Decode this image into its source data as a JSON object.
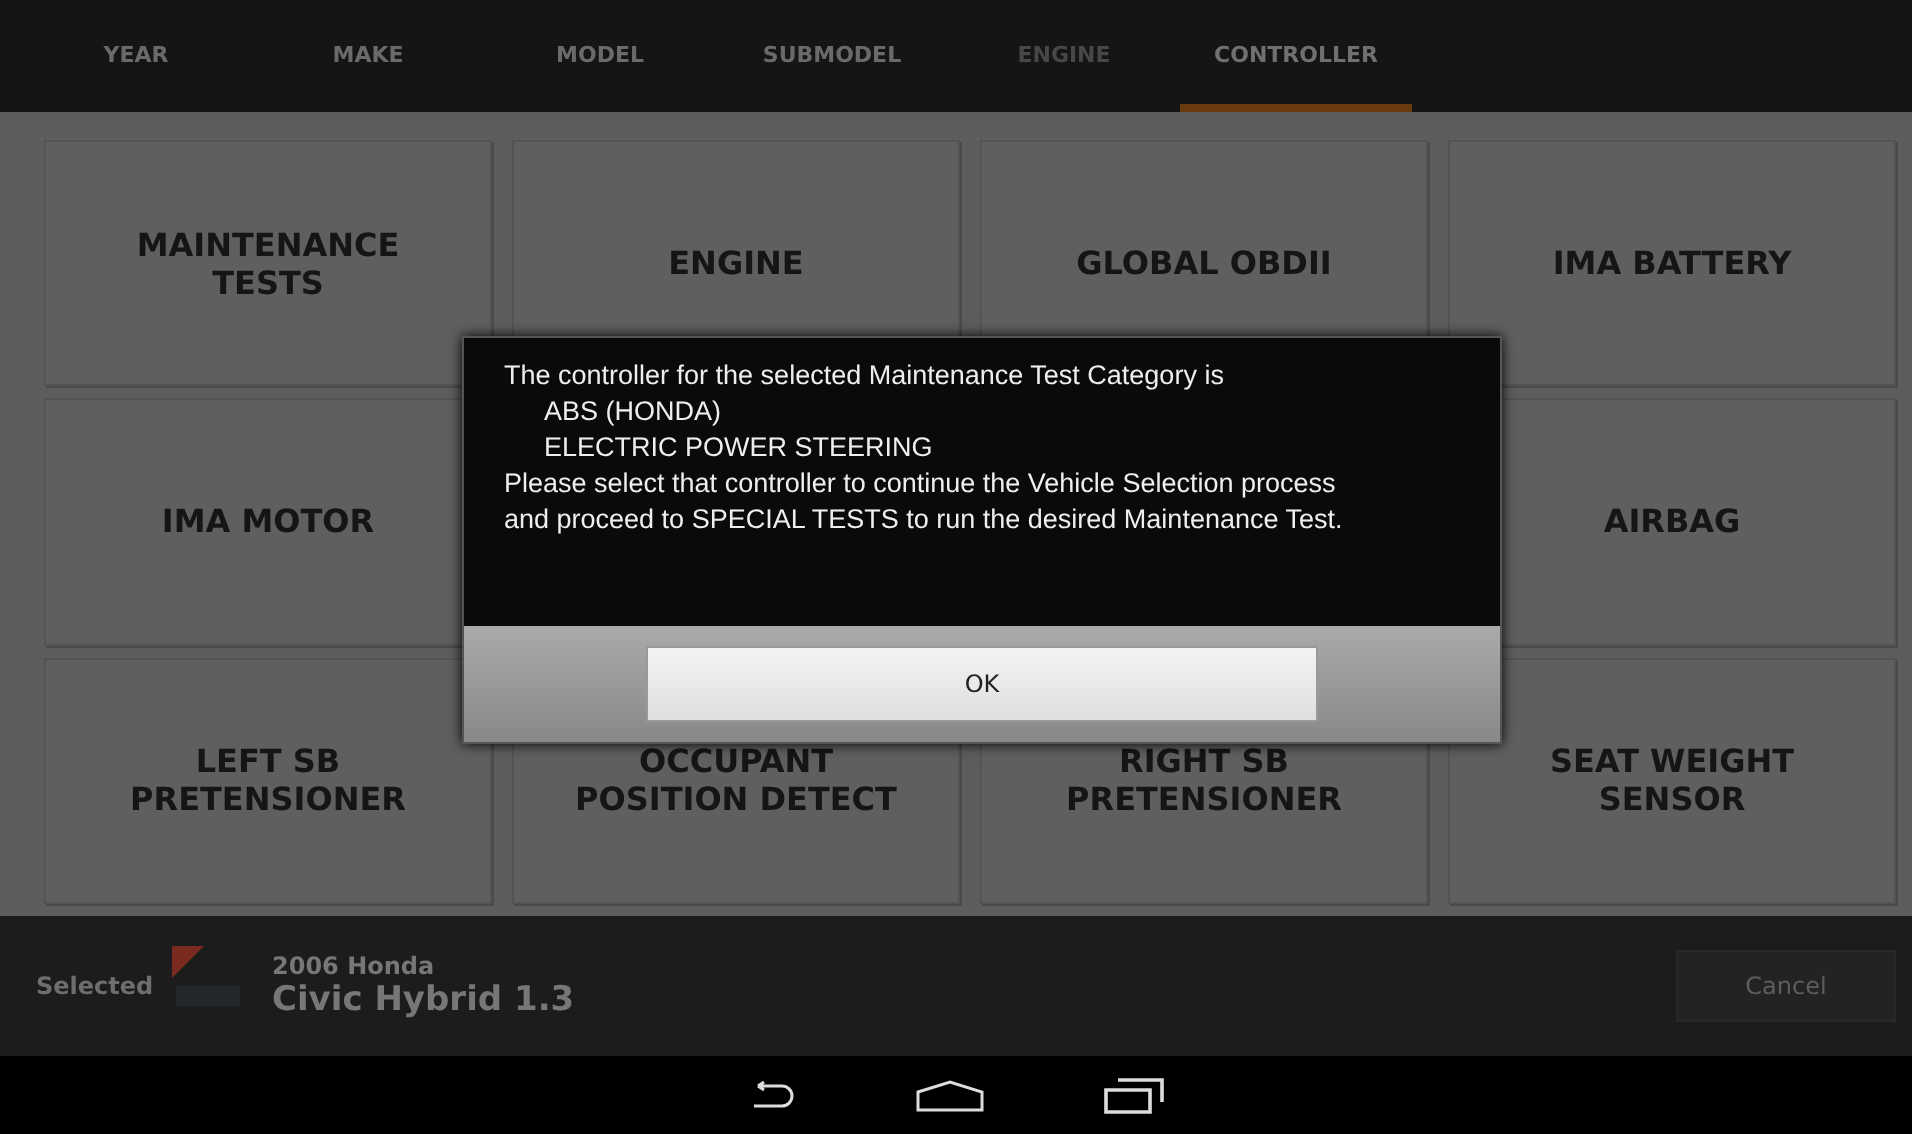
{
  "tabs": [
    {
      "label": "YEAR",
      "selected": false,
      "disabled": false
    },
    {
      "label": "MAKE",
      "selected": false,
      "disabled": false
    },
    {
      "label": "MODEL",
      "selected": false,
      "disabled": false
    },
    {
      "label": "SUBMODEL",
      "selected": false,
      "disabled": false
    },
    {
      "label": "ENGINE",
      "selected": false,
      "disabled": true
    },
    {
      "label": "CONTROLLER",
      "selected": true,
      "disabled": false
    }
  ],
  "tile_rows": [
    [
      "MAINTENANCE TESTS",
      "ENGINE",
      "GLOBAL OBDII",
      "IMA BATTERY"
    ],
    [
      "IMA MOTOR",
      "AIRBAG"
    ],
    [
      "LEFT SB PRETENSIONER",
      "OCCUPANT POSITION DETECT",
      "RIGHT SB PRETENSIONER",
      "SEAT WEIGHT SENSOR"
    ]
  ],
  "dialog": {
    "lines": [
      {
        "text": "The controller for the selected Maintenance Test Category is",
        "indent": false
      },
      {
        "text": "ABS (HONDA)",
        "indent": true
      },
      {
        "text": "ELECTRIC POWER STEERING",
        "indent": true
      },
      {
        "text": "Please select that controller to continue the Vehicle Selection process and proceed to SPECIAL TESTS to run the desired Maintenance Test.",
        "indent": false
      }
    ],
    "button": "OK"
  },
  "selection": {
    "label": "Selected",
    "year_make": "2006 Honda",
    "model": "Civic Hybrid 1.3",
    "cancel": "Cancel"
  }
}
